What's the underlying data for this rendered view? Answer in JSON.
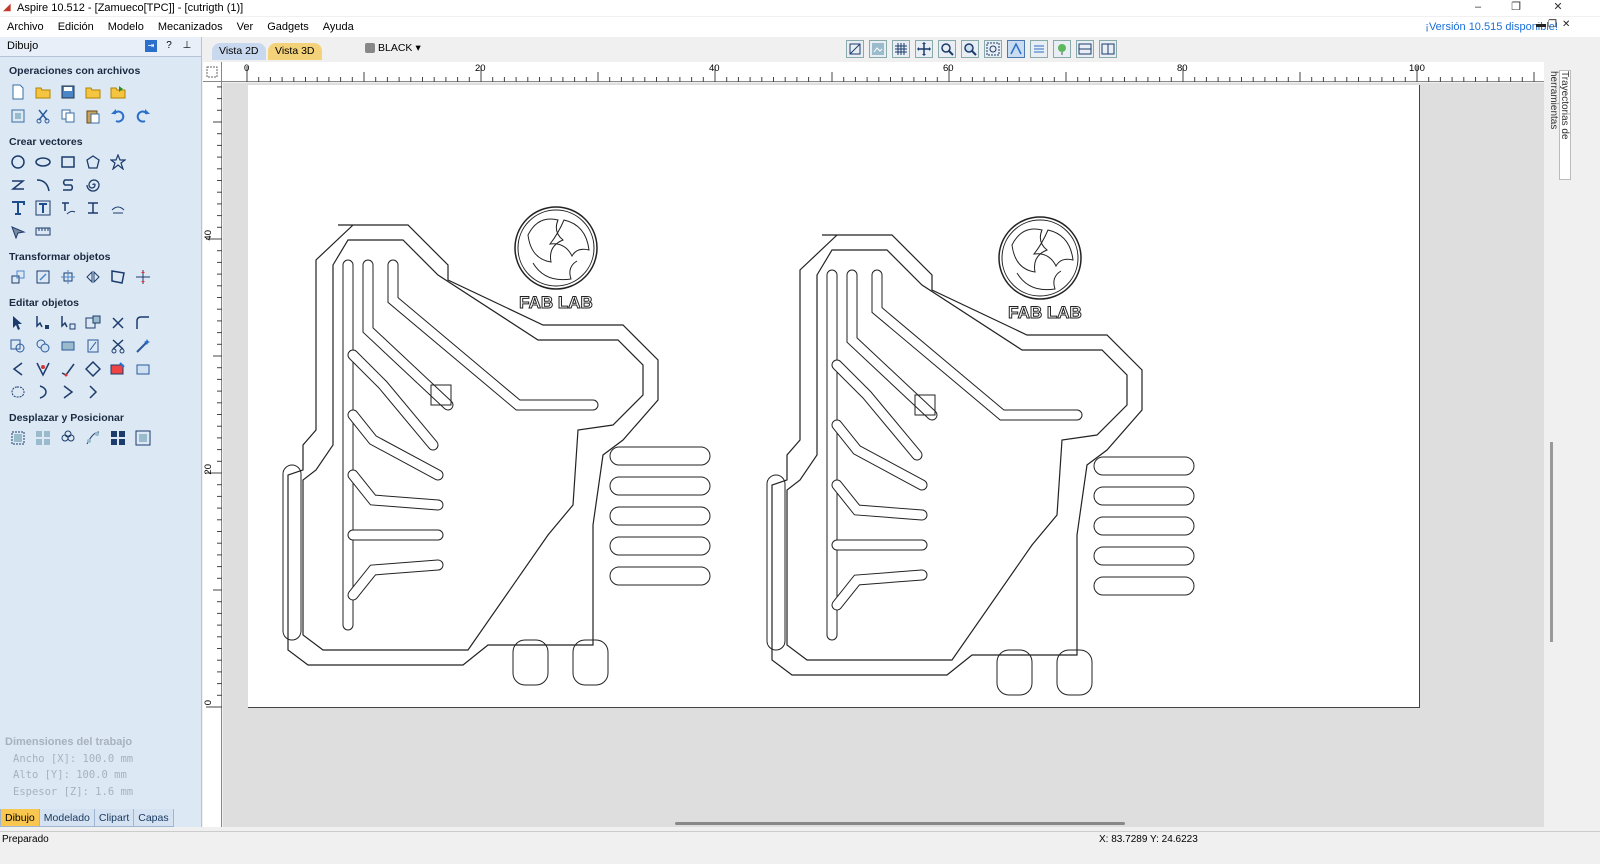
{
  "window": {
    "title": "Aspire 10.512 - [Zamueco[TPC]] - [cutrigth (1)]",
    "controls": [
      "–",
      "❐",
      "✕"
    ]
  },
  "menubar": {
    "items": [
      "Archivo",
      "Edición",
      "Modelo",
      "Mecanizados",
      "Ver",
      "Gadgets",
      "Ayuda"
    ],
    "update_notice": "¡Versión 10.515 disponible!"
  },
  "leftpanel": {
    "title": "Dibujo",
    "sections": {
      "files": "Operaciones con archivos",
      "vectors": "Crear vectores",
      "transform": "Transformar objetos",
      "edit": "Editar objetos",
      "position": "Desplazar y Posicionar"
    },
    "job": {
      "title": "Dimensiones del trabajo",
      "width": "Ancho   [X]: 100.0 mm",
      "height": "Alto    [Y]: 100.0 mm",
      "thickness": "Espesor [Z]: 1.6 mm"
    },
    "tabs": [
      "Dibujo",
      "Modelado",
      "Clipart",
      "Capas"
    ]
  },
  "viewbar": {
    "tab_2d": "Vista 2D",
    "tab_3d": "Vista 3D",
    "layer": "BLACK"
  },
  "rulers": {
    "h_labels": [
      "0",
      "20",
      "40",
      "60",
      "80",
      "100"
    ],
    "v_labels": [
      "40",
      "20",
      "0"
    ]
  },
  "canvas": {
    "logo_text": "FAB LAB"
  },
  "rightdock": {
    "tab": "Trayectorias de herramientas"
  },
  "status": {
    "text": "Preparado",
    "coords": "X: 83.7289 Y: 24.6223"
  },
  "colors": {
    "panel_bg": "#dce8f4",
    "accent_tab": "#f9c74f",
    "update_link": "#1a6fd6"
  }
}
